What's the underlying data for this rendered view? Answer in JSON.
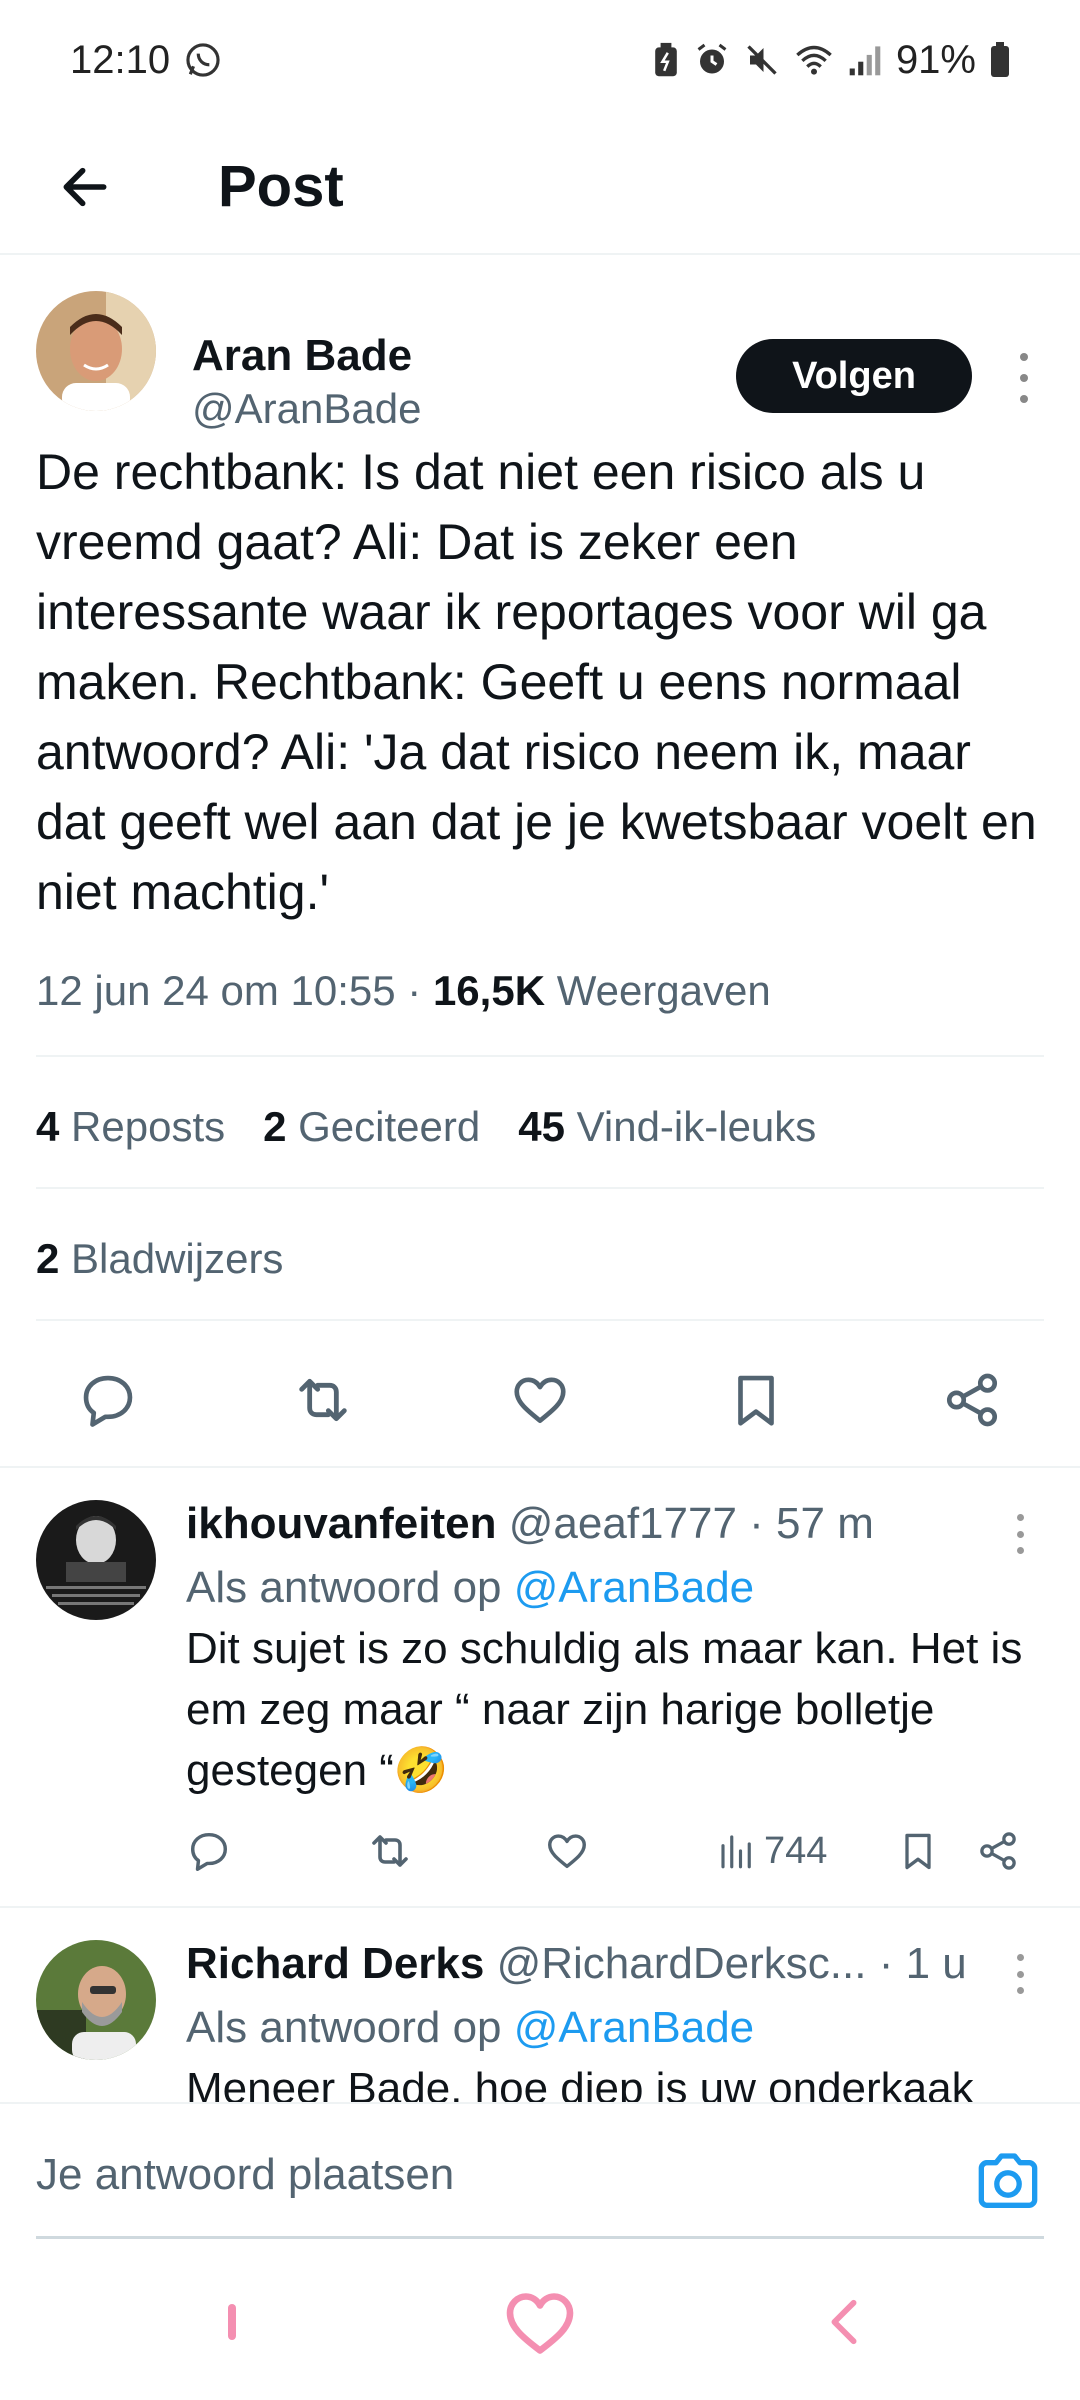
{
  "status_bar": {
    "time": "12:10",
    "battery": "91%",
    "icons": [
      "whatsapp-icon",
      "battery-saver-icon",
      "alarm-icon",
      "mute-icon",
      "wifi-icon",
      "signal-icon",
      "battery-icon"
    ]
  },
  "header": {
    "title": "Post",
    "back_icon": "arrow-left-icon"
  },
  "post": {
    "author_name": "Aran Bade",
    "author_handle": "@AranBade",
    "follow_label": "Volgen",
    "text": "De rechtbank: Is dat niet een risico als u vreemd gaat? Ali: Dat is zeker een interessante waar ik reportages voor wil ga maken. Rechtbank: Geeft u eens normaal antwoord? Ali: 'Ja dat risico neem ik, maar dat geeft wel aan dat je je kwetsbaar voelt en niet machtig.'",
    "date": "12 jun 24 om 10:55",
    "separator": "·",
    "views_count": "16,5K",
    "views_label": "Weergaven",
    "reposts_count": "4",
    "reposts_label": "Reposts",
    "quotes_count": "2",
    "quotes_label": "Geciteerd",
    "likes_count": "45",
    "likes_label": "Vind-ik-leuks",
    "bookmarks_count": "2",
    "bookmarks_label": "Bladwijzers"
  },
  "replies": [
    {
      "name": "ikhouvanfeiten",
      "handle": "@aeaf1777",
      "time": "· 57 m",
      "reply_to_prefix": "Als antwoord op",
      "reply_to_handle": "@AranBade",
      "text": "Dit sujet is zo schuldig als maar kan. Het is em zeg maar “ naar zijn harige bolletje gestegen “🤣",
      "views": "744"
    },
    {
      "name": "Richard Derks",
      "handle": "@RichardDerksc...",
      "time": "· 1 u",
      "reply_to_prefix": "Als antwoord op",
      "reply_to_handle": "@AranBade",
      "text": "Meneer Bade, hoe diep is uw onderkaak"
    }
  ],
  "composer": {
    "placeholder": "Je antwoord plaatsen",
    "camera_icon": "camera-icon"
  },
  "colors": {
    "accent": "#1d9bf0",
    "text": "#0f1419",
    "secondary": "#536471",
    "follow_bg": "#0f1419",
    "nav_pink": "#f48fb1"
  }
}
